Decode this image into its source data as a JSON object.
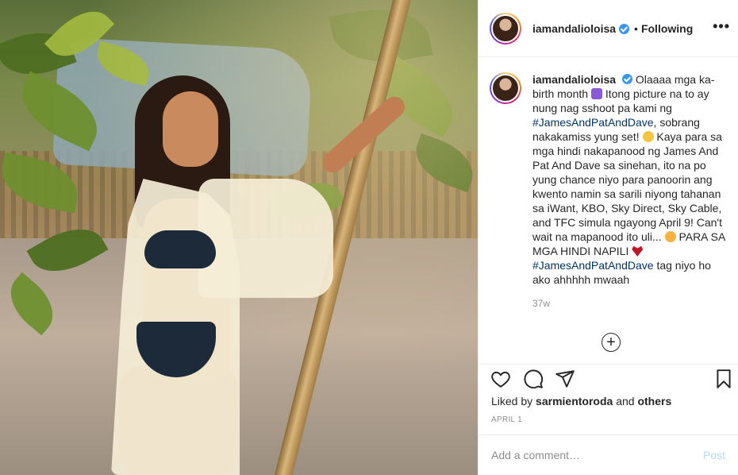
{
  "post": {
    "username": "iamandalioloisa",
    "follow_status": "Following",
    "separator": "•",
    "more_icon": "more-horizontal-icon",
    "caption": {
      "username": "iamandalioloisa",
      "text_1": "Olaaaa mga ka-birth month",
      "text_2": "Itong picture na to ay nung nag sshoot pa kami ng",
      "tag_1": "#JamesAndPatAndDave",
      "text_3": ", sobrang nakakamiss yung set!",
      "text_4": "Kaya para sa mga hindi nakapanood ng James And Pat And Dave sa sinehan, ito na po yung chance niyo para panoorin ang kwento namin sa sarili niyong tahanan sa iWant, KBO, Sky Direct, Sky Cable, and TFC simula ngayong April 9! Can't wait na mapanood ito uli...",
      "text_5": "PARA SA MGA HINDI NAPILI",
      "tag_2": "#JamesAndPatAndDave",
      "text_6": "tag niyo ho ako ahhhhh mwaah"
    },
    "time_ago": "37w",
    "load_more_symbol": "+",
    "likes": {
      "prefix": "Liked by",
      "user": "sarmientoroda",
      "middle": "and",
      "others": "others"
    },
    "date": "APRIL 1",
    "comment_placeholder": "Add a comment…",
    "post_label": "Post"
  },
  "colors": {
    "text": "#262626",
    "muted": "#8e8e8e",
    "hashtag": "#003569",
    "verified": "#3897f0",
    "post_disabled": "#b2dffc",
    "border": "#efefef"
  }
}
